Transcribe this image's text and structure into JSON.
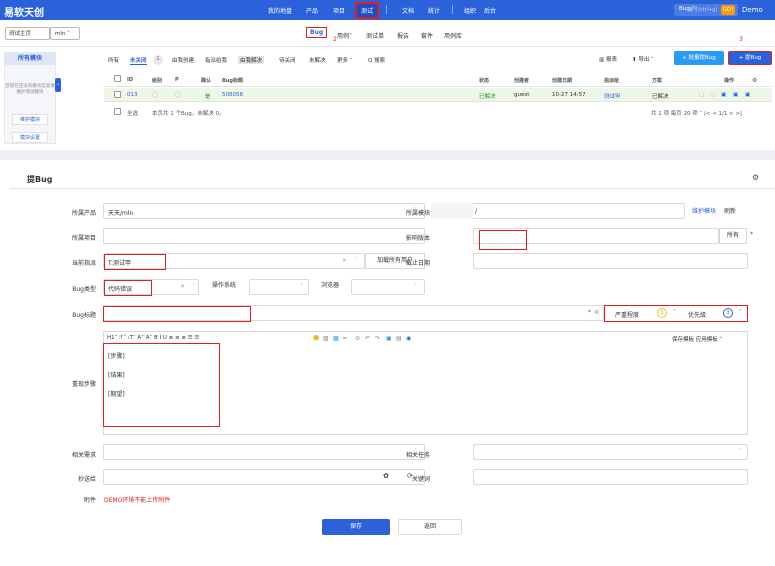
{
  "topbar": {
    "brand": "易软天创",
    "nav": [
      "我的地盘",
      "产品",
      "项目",
      "测试",
      "文档",
      "统计",
      "组织",
      "后台"
    ],
    "search_type": "Bug ˅",
    "search_placeholder": "编号(ctrl+g)",
    "go_label": "GO!",
    "user": "Demo"
  },
  "subbar": {
    "home": "测试主页",
    "product": "mln ˅",
    "tabs": [
      "Bug",
      "用例˅",
      "测试单",
      "报告",
      "套件",
      "用例库"
    ],
    "annotation_2": "2"
  },
  "leftpanel": {
    "all_modules": "所有模块",
    "empty_tip": "您现在还没有模块信息请维护测试模块",
    "maintain": "维护模块",
    "settings": "模块设置",
    "collapse": "‹"
  },
  "filters": [
    "所有",
    "未关闭",
    "由我创建",
    "指派给我",
    "由我解决",
    "待关闭",
    "未解决",
    "更多 ˅",
    "Q 搜索"
  ],
  "unclosed_count": "1",
  "tools": {
    "report": "报表",
    "export": "导出 ˅",
    "batch": "+ 批量提Bug",
    "report_bug": "+ 提Bug",
    "annotation_3": "3"
  },
  "table": {
    "headers": [
      "ID",
      "级别",
      "P",
      "确认",
      "Bug标题",
      "状态",
      "创建者",
      "创建日期",
      "指派给",
      "方案",
      "操作"
    ],
    "rows": [
      {
        "id": "013",
        "confirm": "是",
        "title": "508058",
        "status": "已解决",
        "creator": "guest",
        "date": "10-27 14:57",
        "assigned": "测试甲",
        "solution": "已解决"
      }
    ],
    "select_all": "全选",
    "summary": "本页共 1 个Bug，未解决 0。",
    "pager": "共 1 项  每页 20 项 ˅  |<  <  1/1  >  >|"
  },
  "form": {
    "title": "提Bug",
    "labels": {
      "product": "所属产品",
      "module": "所属模块",
      "project": "所属项目",
      "build": "影响版本",
      "assign": "当前指派",
      "deadline": "截止日期",
      "type": "Bug类型",
      "os": "操作系统",
      "browser": "浏览器",
      "bug_title": "Bug标题",
      "severity": "严重程度",
      "priority": "优先级",
      "steps": "重现步骤",
      "story": "相关需求",
      "task": "相关任务",
      "mailto": "抄送给",
      "keywords": "关键词",
      "files": "附件"
    },
    "values": {
      "product": "天天/mln",
      "module": "/",
      "assign": "T:测试甲",
      "type": "代码错误",
      "severity": "3",
      "priority": "3"
    },
    "links": {
      "maintain": "维护模块",
      "refresh": "刷新",
      "all": "所有",
      "load_users": "加载所有用户"
    },
    "editor_toolbar": "H1˅  ℱ˅  ₜT˅   A˅  A˅  B  I  U   ≡  ≡  ≡  ☰  ☰",
    "editor_right": "保存模板   应用模板 ˅",
    "steps_lines": [
      "[步骤]",
      "[结果]",
      "[期望]"
    ],
    "attach_note": "DEMO环境不能上传附件",
    "save": "保存",
    "back": "返回"
  }
}
